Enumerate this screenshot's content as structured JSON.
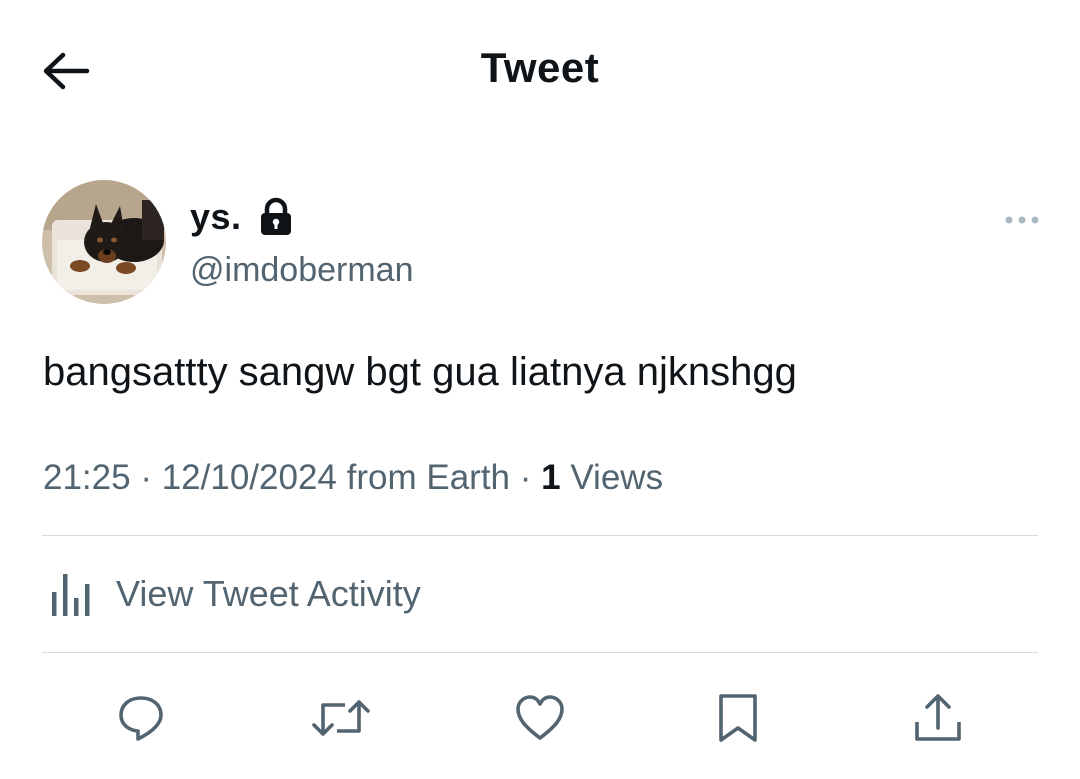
{
  "header": {
    "title": "Tweet",
    "back_icon": "back-arrow-icon"
  },
  "tweet": {
    "author_name": "ys.",
    "author_handle": "@imdoberman",
    "protected_icon": "lock-icon",
    "avatar_description": "avatar-photo",
    "text": "bangsattty sangw bgt gua liatnya njknshgg",
    "time": "21:25",
    "separator": "·",
    "date": "12/10/2024",
    "source": "from Earth",
    "views_count": "1",
    "views_label": "Views"
  },
  "activity": {
    "label": "View Tweet Activity",
    "icon": "analytics-icon"
  },
  "actions": [
    {
      "name": "reply",
      "icon": "reply-icon"
    },
    {
      "name": "retweet",
      "icon": "retweet-icon"
    },
    {
      "name": "like",
      "icon": "heart-icon"
    },
    {
      "name": "bookmark",
      "icon": "bookmark-icon"
    },
    {
      "name": "share",
      "icon": "share-icon"
    }
  ],
  "colors": {
    "text_primary": "#0f1419",
    "text_secondary": "#536471",
    "divider": "#d6dbdf",
    "icon_gray": "#536471"
  }
}
